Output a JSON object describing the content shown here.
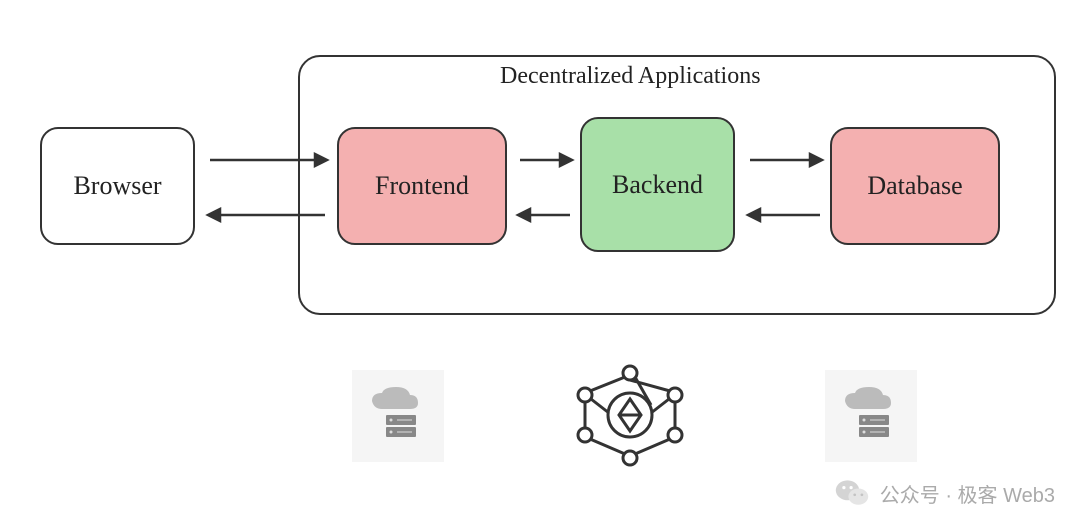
{
  "diagram": {
    "title": "Decentralized Applications",
    "nodes": {
      "browser": "Browser",
      "frontend": "Frontend",
      "backend": "Backend",
      "database": "Database"
    },
    "icons": {
      "left": "cloud-server-icon",
      "center": "blockchain-network-icon",
      "right": "cloud-server-icon"
    },
    "arrows": [
      {
        "from": "browser",
        "to": "frontend",
        "dir": "right"
      },
      {
        "from": "frontend",
        "to": "browser",
        "dir": "left"
      },
      {
        "from": "frontend",
        "to": "backend",
        "dir": "right"
      },
      {
        "from": "backend",
        "to": "frontend",
        "dir": "left"
      },
      {
        "from": "backend",
        "to": "database",
        "dir": "right"
      },
      {
        "from": "database",
        "to": "backend",
        "dir": "left"
      }
    ]
  },
  "watermark": {
    "text": "公众号 · 极客 Web3"
  }
}
